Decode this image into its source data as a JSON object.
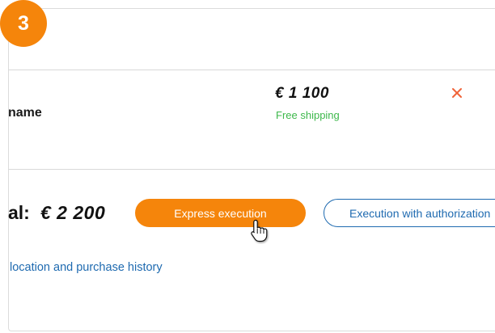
{
  "step": {
    "number": "3"
  },
  "item": {
    "name_partial": "name",
    "price": "€ 1 100",
    "shipping": "Free shipping",
    "remove_icon": "close-icon",
    "accent_remove": "#f0643a"
  },
  "summary": {
    "total_label_partial": "al:",
    "total_value": "€ 2 200"
  },
  "actions": {
    "express_label": "Express execution",
    "authorization_label": "Execution with authorization"
  },
  "links": {
    "history_partial": "location and purchase history"
  },
  "colors": {
    "brand_orange": "#f5850b",
    "link_blue": "#1e6ab0",
    "success_green": "#3db84b"
  },
  "cursor": {
    "type": "hand-pointer-icon"
  }
}
